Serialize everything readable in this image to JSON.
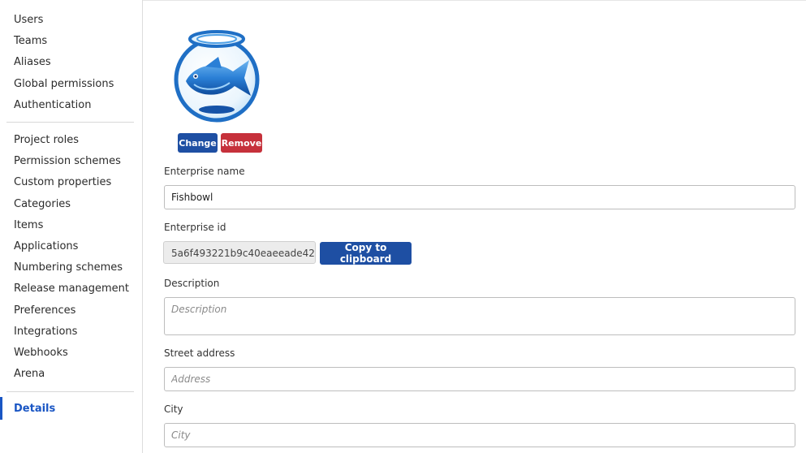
{
  "sidebar": {
    "group1": [
      "Users",
      "Teams",
      "Aliases",
      "Global permissions",
      "Authentication"
    ],
    "group2": [
      "Project roles",
      "Permission schemes",
      "Custom properties",
      "Categories",
      "Items",
      "Applications",
      "Numbering schemes",
      "Release management",
      "Preferences",
      "Integrations",
      "Webhooks",
      "Arena"
    ],
    "active": "Details"
  },
  "logo": {
    "icon": "fishbowl-logo"
  },
  "buttons": {
    "change": "Change",
    "remove": "Remove",
    "copy": "Copy to clipboard"
  },
  "form": {
    "enterprise_name_label": "Enterprise name",
    "enterprise_name_value": "Fishbowl",
    "enterprise_id_label": "Enterprise id",
    "enterprise_id_value": "5a6f493221b9c40eaeeade42",
    "description_label": "Description",
    "description_placeholder": "Description",
    "street_address_label": "Street address",
    "street_address_placeholder": "Address",
    "city_label": "City",
    "city_placeholder": "City"
  },
  "colors": {
    "primary": "#1e4fa3",
    "danger": "#c6313b",
    "active_nav": "#1a56c4"
  }
}
